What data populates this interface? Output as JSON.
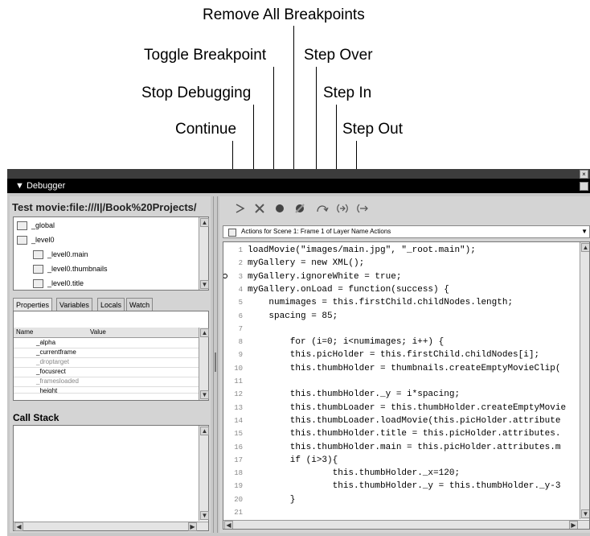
{
  "callouts": {
    "remove_all_breakpoints": "Remove All Breakpoints",
    "toggle_breakpoint": "Toggle Breakpoint",
    "step_over": "Step Over",
    "stop_debugging": "Stop Debugging",
    "step_in": "Step In",
    "continue": "Continue",
    "step_out": "Step Out"
  },
  "panel": {
    "title": "▼ Debugger",
    "title_bg": "#000000"
  },
  "left": {
    "movie_title": "Test movie:file:///I|/Book%20Projects/",
    "tree": [
      "_global",
      "_level0",
      "_level0.main",
      "_level0.thumbnails",
      "_level0.title"
    ],
    "tabs": [
      "Properties",
      "Variables",
      "Locals",
      "Watch"
    ],
    "props_headers": [
      "Name",
      "Value"
    ],
    "props_rows": [
      "_alpha",
      "_currentframe",
      "_droptarget",
      "_focusrect",
      "_framesloaded",
      "_height"
    ],
    "call_stack_label": "Call Stack"
  },
  "right": {
    "script_selector": "Actions for Scene 1: Frame 1 of Layer Name Actions",
    "toolbar_icons": [
      "continue-icon",
      "stop-debugging-icon",
      "toggle-breakpoint-icon",
      "remove-all-breakpoints-icon",
      "step-over-icon",
      "step-in-icon",
      "step-out-icon"
    ],
    "code_lines": [
      {
        "n": "1",
        "t": "loadMovie(\"images/main.jpg\", \"_root.main\");"
      },
      {
        "n": "2",
        "t": "myGallery = new XML();"
      },
      {
        "n": "3",
        "t": "myGallery.ignoreWhite = true;"
      },
      {
        "n": "4",
        "t": "myGallery.onLoad = function(success) {"
      },
      {
        "n": "5",
        "t": "    numimages = this.firstChild.childNodes.length;"
      },
      {
        "n": "6",
        "t": "    spacing = 85;"
      },
      {
        "n": "7",
        "t": ""
      },
      {
        "n": "8",
        "t": "        for (i=0; i<numimages; i++) {"
      },
      {
        "n": "9",
        "t": "        this.picHolder = this.firstChild.childNodes[i];"
      },
      {
        "n": "10",
        "t": "        this.thumbHolder = thumbnails.createEmptyMovieClip("
      },
      {
        "n": "11",
        "t": ""
      },
      {
        "n": "12",
        "t": "        this.thumbHolder._y = i*spacing;"
      },
      {
        "n": "13",
        "t": "        this.thumbLoader = this.thumbHolder.createEmptyMovie"
      },
      {
        "n": "14",
        "t": "        this.thumbLoader.loadMovie(this.picHolder.attribute"
      },
      {
        "n": "15",
        "t": "        this.thumbHolder.title = this.picHolder.attributes."
      },
      {
        "n": "16",
        "t": "        this.thumbHolder.main = this.picHolder.attributes.m"
      },
      {
        "n": "17",
        "t": "        if (i>3){"
      },
      {
        "n": "18",
        "t": "                this.thumbHolder._x=120;"
      },
      {
        "n": "19",
        "t": "                this.thumbHolder._y = this.thumbHolder._y-3"
      },
      {
        "n": "20",
        "t": "        }"
      },
      {
        "n": "21",
        "t": ""
      }
    ],
    "breakpoint_line": "3"
  }
}
